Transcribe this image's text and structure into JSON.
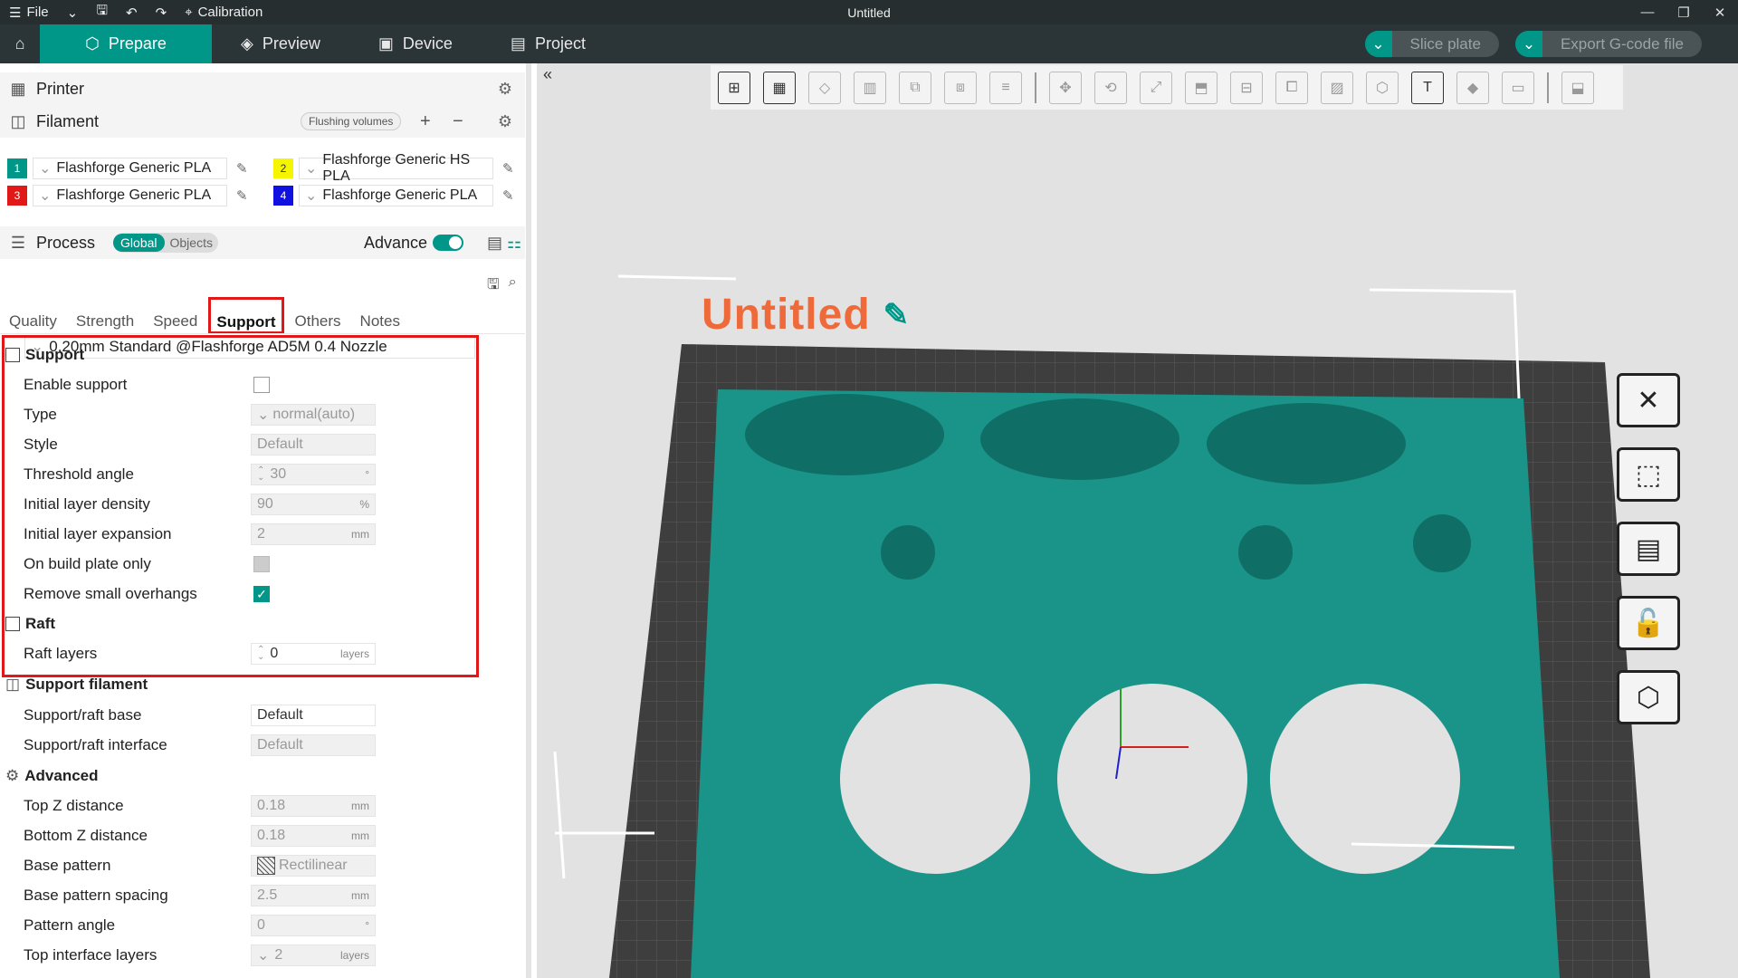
{
  "titlebar": {
    "file": "File",
    "calibration": "Calibration",
    "title": "Untitled"
  },
  "nav": {
    "tabs": [
      "Prepare",
      "Preview",
      "Device",
      "Project"
    ],
    "slice": "Slice plate",
    "export": "Export G-code file"
  },
  "printer": {
    "label": "Printer"
  },
  "filament": {
    "label": "Filament",
    "flushing": "Flushing volumes",
    "items": [
      {
        "num": "1",
        "color": "#009688",
        "name": "Flashforge Generic PLA"
      },
      {
        "num": "2",
        "color": "#f5f500",
        "name": "Flashforge Generic HS PLA"
      },
      {
        "num": "3",
        "color": "#e01818",
        "name": "Flashforge Generic PLA"
      },
      {
        "num": "4",
        "color": "#1010e0",
        "name": "Flashforge Generic PLA"
      }
    ]
  },
  "process": {
    "label": "Process",
    "global": "Global",
    "objects": "Objects",
    "advance": "Advance",
    "preset": "0.20mm Standard @Flashforge AD5M 0.4 Nozzle",
    "tabs": [
      "Quality",
      "Strength",
      "Speed",
      "Support",
      "Others",
      "Notes"
    ]
  },
  "support": {
    "title": "Support",
    "enable": "Enable support",
    "type": "Type",
    "type_val": "normal(auto)",
    "style": "Style",
    "style_val": "Default",
    "threshold": "Threshold angle",
    "threshold_val": "30",
    "threshold_unit": "°",
    "density": "Initial layer density",
    "density_val": "90",
    "density_unit": "%",
    "expansion": "Initial layer expansion",
    "expansion_val": "2",
    "expansion_unit": "mm",
    "buildplate": "On build plate only",
    "overhangs": "Remove small overhangs"
  },
  "raft": {
    "title": "Raft",
    "layers": "Raft layers",
    "layers_val": "0",
    "layers_unit": "layers"
  },
  "support_filament": {
    "title": "Support filament",
    "base": "Support/raft base",
    "base_val": "Default",
    "interface": "Support/raft interface",
    "interface_val": "Default"
  },
  "advanced": {
    "title": "Advanced",
    "topz": "Top Z distance",
    "topz_val": "0.18",
    "botz": "Bottom Z distance",
    "botz_val": "0.18",
    "pattern": "Base pattern",
    "pattern_val": "Rectilinear",
    "spacing": "Base pattern spacing",
    "spacing_val": "2.5",
    "angle": "Pattern angle",
    "angle_val": "0",
    "angle_unit": "°",
    "toplayers": "Top interface layers",
    "toplayers_val": "2",
    "toplayers_unit": "layers",
    "unit_mm": "mm"
  },
  "plate": {
    "name": "Untitled"
  }
}
